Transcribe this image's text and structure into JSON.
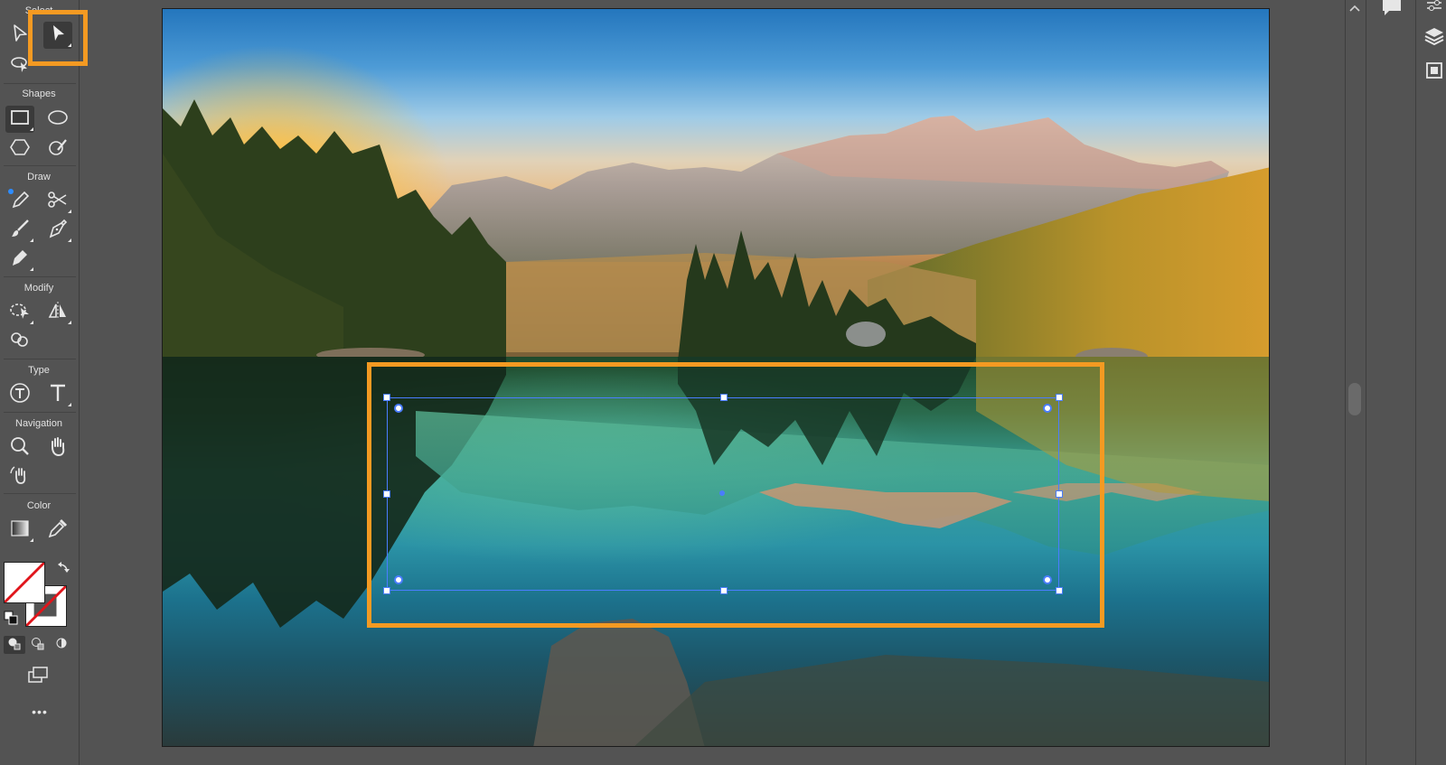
{
  "toolbar": {
    "sections": {
      "select": "Select",
      "shapes": "Shapes",
      "draw": "Draw",
      "modify": "Modify",
      "type": "Type",
      "navigation": "Navigation",
      "color": "Color"
    },
    "more_label": "•••"
  },
  "colors": {
    "accent_highlight": "#f49a22",
    "selection_blue": "#4a7dff",
    "ui_background": "#535353"
  }
}
